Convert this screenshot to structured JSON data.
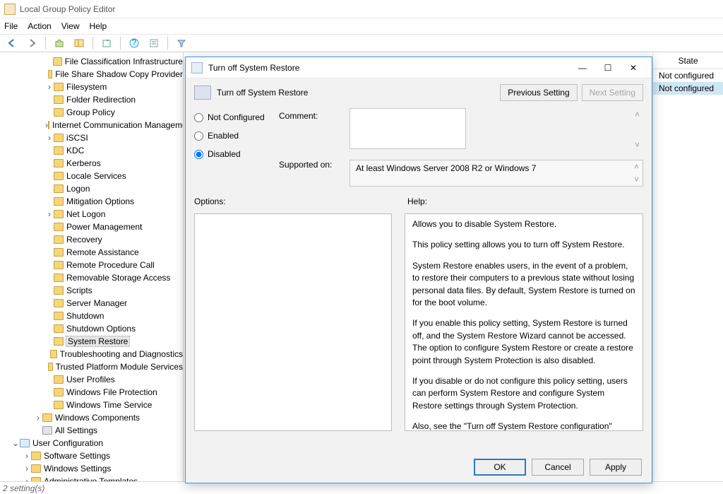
{
  "window": {
    "title": "Local Group Policy Editor"
  },
  "menu": [
    "File",
    "Action",
    "View",
    "Help"
  ],
  "tree": [
    {
      "d": 4,
      "e": "",
      "t": "File Classification Infrastructure"
    },
    {
      "d": 4,
      "e": "",
      "t": "File Share Shadow Copy Provider"
    },
    {
      "d": 4,
      "e": ">",
      "t": "Filesystem"
    },
    {
      "d": 4,
      "e": "",
      "t": "Folder Redirection"
    },
    {
      "d": 4,
      "e": "",
      "t": "Group Policy"
    },
    {
      "d": 4,
      "e": ">",
      "t": "Internet Communication Management"
    },
    {
      "d": 4,
      "e": ">",
      "t": "iSCSI"
    },
    {
      "d": 4,
      "e": "",
      "t": "KDC"
    },
    {
      "d": 4,
      "e": "",
      "t": "Kerberos"
    },
    {
      "d": 4,
      "e": "",
      "t": "Locale Services"
    },
    {
      "d": 4,
      "e": "",
      "t": "Logon"
    },
    {
      "d": 4,
      "e": "",
      "t": "Mitigation Options"
    },
    {
      "d": 4,
      "e": ">",
      "t": "Net Logon"
    },
    {
      "d": 4,
      "e": "",
      "t": "Power Management"
    },
    {
      "d": 4,
      "e": "",
      "t": "Recovery"
    },
    {
      "d": 4,
      "e": "",
      "t": "Remote Assistance"
    },
    {
      "d": 4,
      "e": "",
      "t": "Remote Procedure Call"
    },
    {
      "d": 4,
      "e": "",
      "t": "Removable Storage Access"
    },
    {
      "d": 4,
      "e": "",
      "t": "Scripts"
    },
    {
      "d": 4,
      "e": "",
      "t": "Server Manager"
    },
    {
      "d": 4,
      "e": "",
      "t": "Shutdown"
    },
    {
      "d": 4,
      "e": "",
      "t": "Shutdown Options"
    },
    {
      "d": 4,
      "e": "",
      "t": "System Restore",
      "sel": true
    },
    {
      "d": 4,
      "e": "",
      "t": "Troubleshooting and Diagnostics"
    },
    {
      "d": 4,
      "e": "",
      "t": "Trusted Platform Module Services"
    },
    {
      "d": 4,
      "e": "",
      "t": "User Profiles"
    },
    {
      "d": 4,
      "e": "",
      "t": "Windows File Protection"
    },
    {
      "d": 4,
      "e": "",
      "t": "Windows Time Service"
    },
    {
      "d": 3,
      "e": ">",
      "t": "Windows Components"
    },
    {
      "d": 3,
      "e": "",
      "t": "All Settings",
      "icon": "all"
    },
    {
      "d": 1,
      "e": "v",
      "t": "User Configuration",
      "icon": "users"
    },
    {
      "d": 2,
      "e": ">",
      "t": "Software Settings"
    },
    {
      "d": 2,
      "e": ">",
      "t": "Windows Settings"
    },
    {
      "d": 2,
      "e": ">",
      "t": "Administrative Templates"
    }
  ],
  "statecol": {
    "header": "State",
    "rows": [
      "Not configured",
      "Not configured"
    ]
  },
  "status": "2 setting(s)",
  "dialog": {
    "title": "Turn off System Restore",
    "heading": "Turn off System Restore",
    "prev": "Previous Setting",
    "next": "Next Setting",
    "radios": {
      "notconf": "Not Configured",
      "enabled": "Enabled",
      "disabled": "Disabled",
      "selected": "disabled"
    },
    "commentLabel": "Comment:",
    "supportedLabel": "Supported on:",
    "supported": "At least Windows Server 2008 R2 or Windows 7",
    "optionsLabel": "Options:",
    "helpLabel": "Help:",
    "help": [
      "Allows you to disable System Restore.",
      "This policy setting allows you to turn off System Restore.",
      "System Restore enables users, in the event of a problem, to restore their computers to a previous state without losing personal data files. By default, System Restore is turned on for the boot volume.",
      "If you enable this policy setting, System Restore is turned off, and the System Restore Wizard cannot be accessed. The option to configure System Restore or create a restore point through System Protection is also disabled.",
      "If you disable or do not configure this policy setting, users can perform System Restore and configure System Restore settings through System Protection.",
      "Also, see the \"Turn off System Restore configuration\" policy setting. If the \"Turn off System Restore\" policy setting is disabled or not configured, the \"Turn off System Restore configuration\""
    ],
    "buttons": {
      "ok": "OK",
      "cancel": "Cancel",
      "apply": "Apply"
    }
  }
}
